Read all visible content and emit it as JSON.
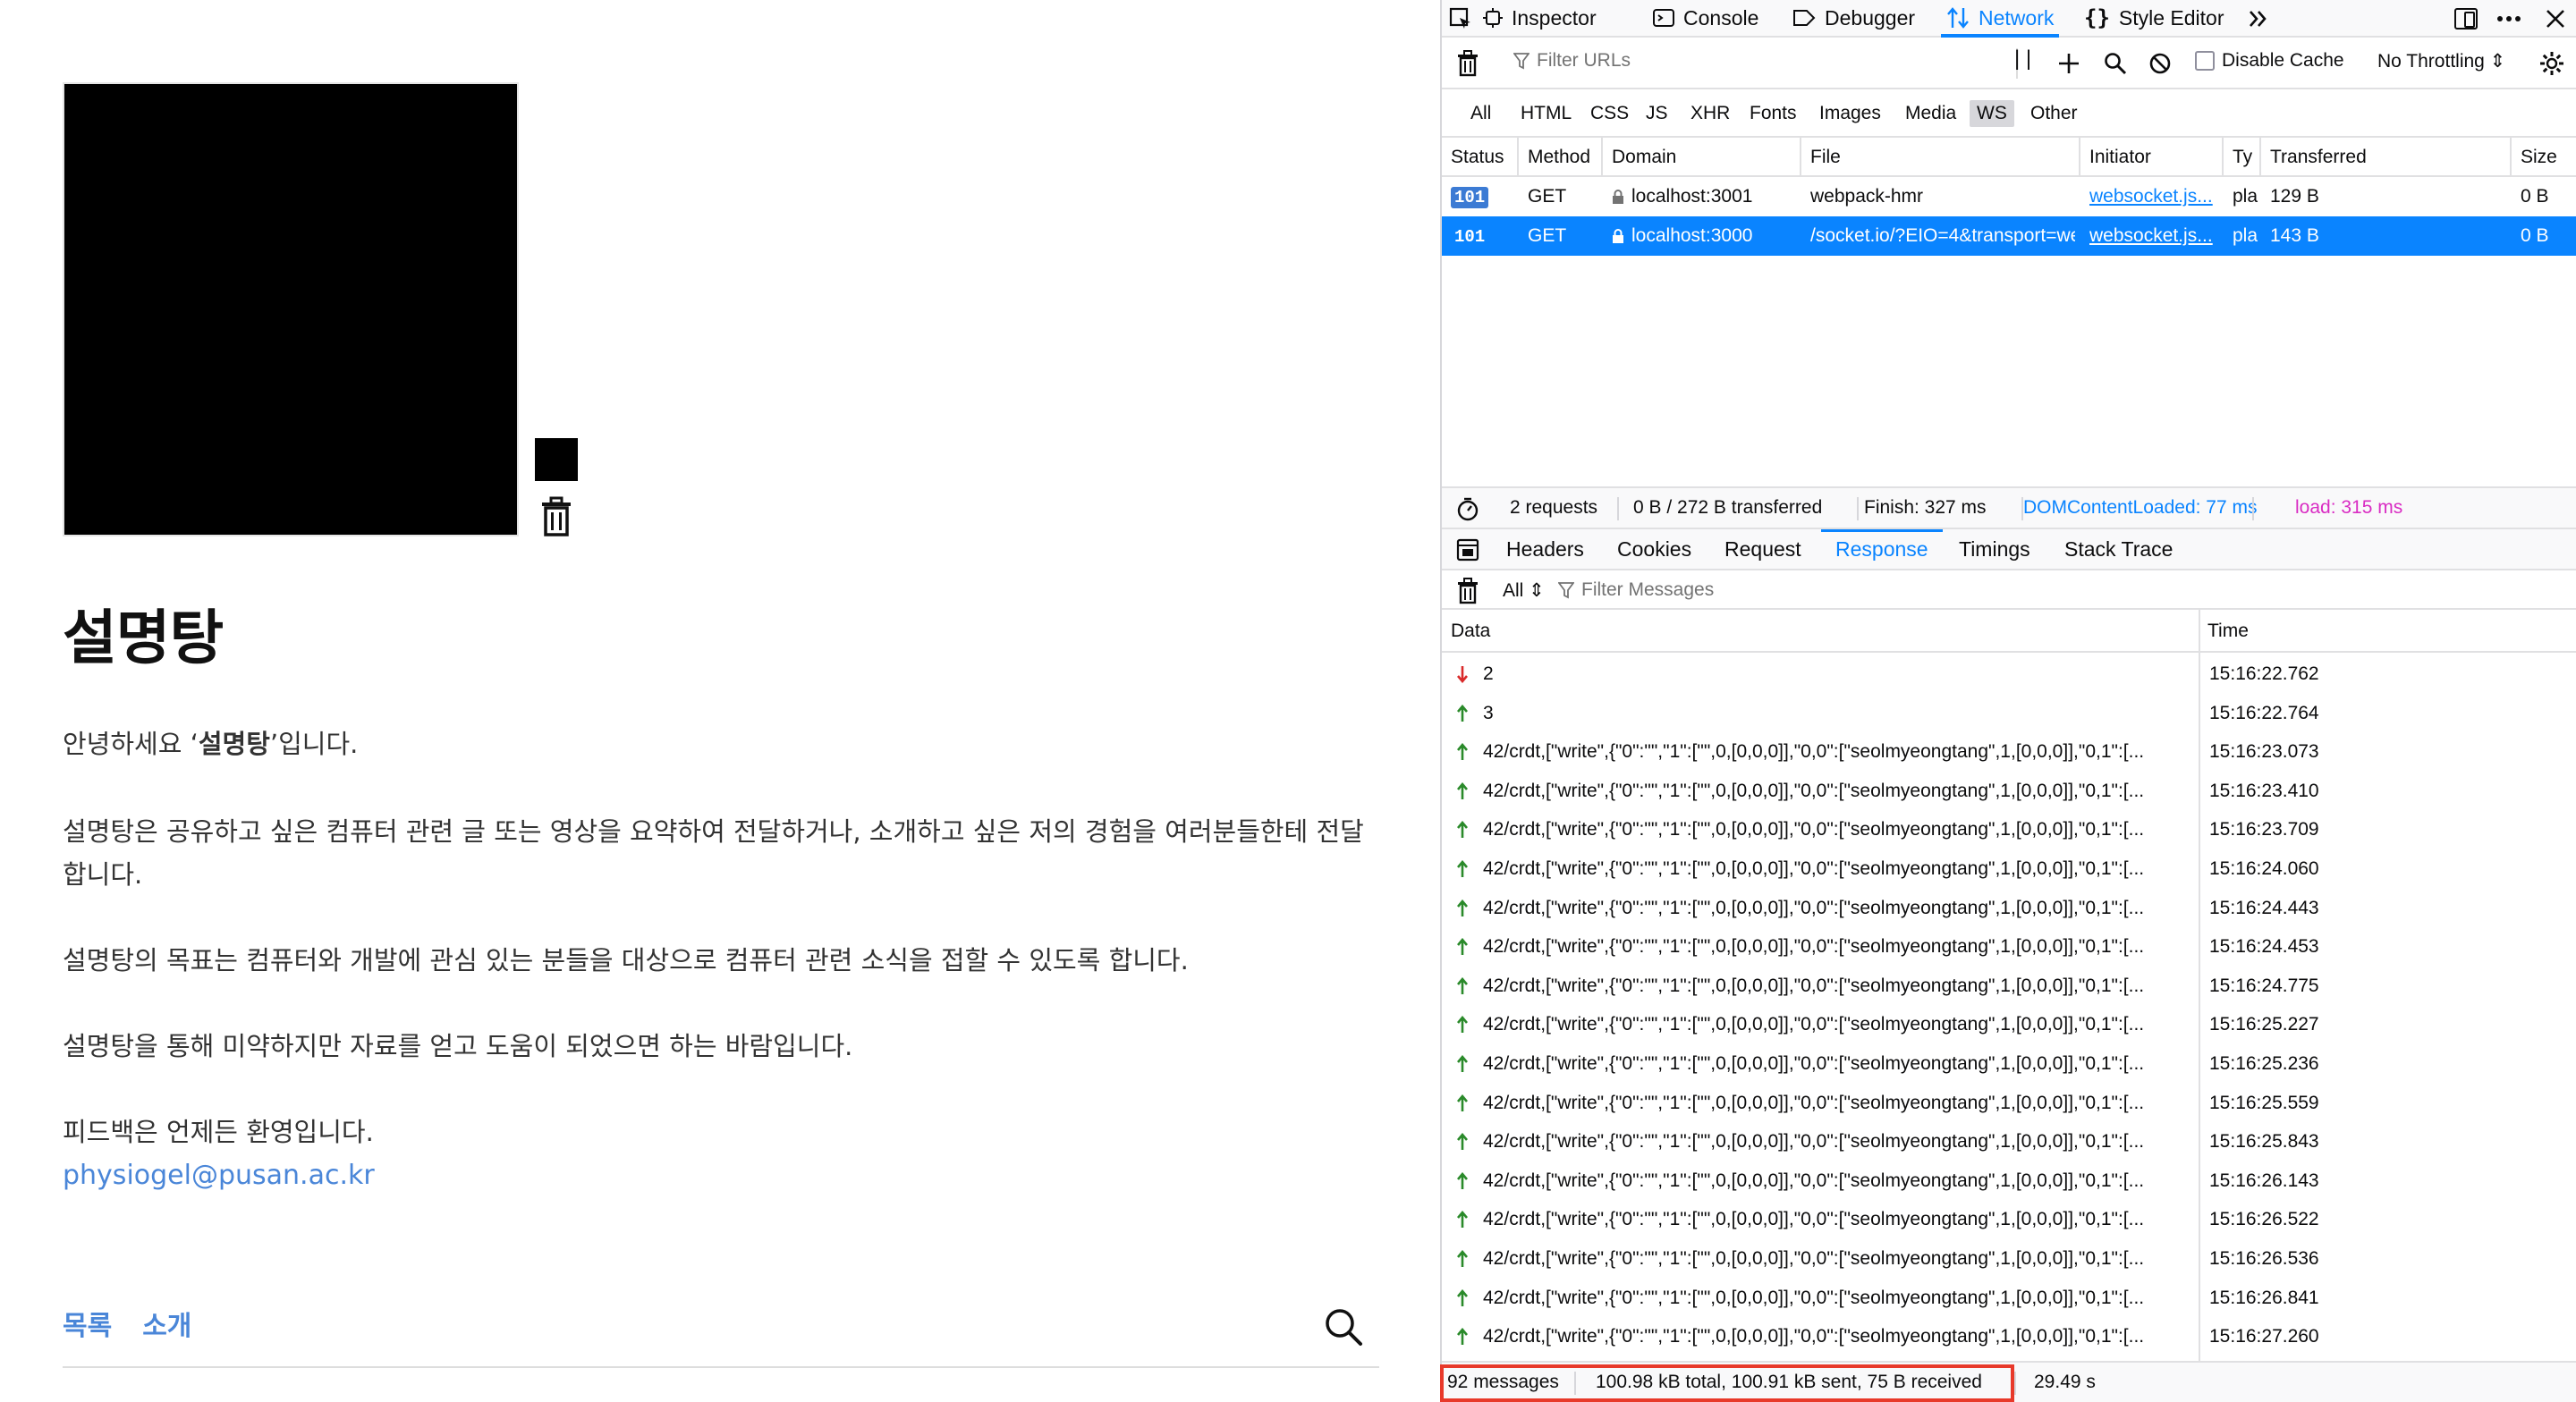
{
  "blog": {
    "title": "설명탕",
    "intro_prefix": "안녕하세요 ‘",
    "intro_bold": "설명탕",
    "intro_suffix": "’입니다.",
    "paragraph_2": "설명탕은 공유하고 싶은 컴퓨터 관련 글 또는 영상을 요약하여 전달하거나, 소개하고 싶은 저의 경험을 여러분들한테 전달합니다.",
    "paragraph_3": "설명탕의 목표는 컴퓨터와 개발에 관심 있는 분들을 대상으로 컴퓨터 관련 소식을 접할 수 있도록 합니다.",
    "paragraph_4": "설명탕을 통해 미약하지만 자료를 얻고 도움이 되었으면 하는 바람입니다.",
    "paragraph_5": "피드백은 언제든 환영입니다.",
    "email": "physiogel@pusan.ac.kr",
    "nav": [
      "목록",
      "소개"
    ],
    "icons": {
      "trash": "trash-icon",
      "search": "search-icon"
    }
  },
  "devtools": {
    "toolbar": {
      "tabs": [
        "Inspector",
        "Console",
        "Debugger",
        "Network",
        "Style Editor"
      ],
      "active_tab": "Network",
      "icons": [
        "pick-element-icon",
        "inspector-icon",
        "console-icon",
        "debugger-icon",
        "network-icon",
        "style-editor-icon",
        "more-tabs-icon",
        "responsive-icon",
        "meatball-icon",
        "close-icon"
      ]
    },
    "filter": {
      "placeholder": "Filter URLs",
      "disable_cache": "Disable Cache",
      "throttling": "No Throttling ⇕"
    },
    "types": [
      "All",
      "HTML",
      "CSS",
      "JS",
      "XHR",
      "Fonts",
      "Images",
      "Media",
      "WS",
      "Other"
    ],
    "active_type": "WS",
    "request_columns": [
      "Status",
      "Method",
      "Domain",
      "File",
      "Initiator",
      "Ty",
      "Transferred",
      "Size"
    ],
    "requests": [
      {
        "status": "101",
        "method": "GET",
        "domain": "localhost:3001",
        "file": "webpack-hmr",
        "initiator": "websocket.js...",
        "type": "pla",
        "transferred": "129 B",
        "size": "0 B",
        "selected": false
      },
      {
        "status": "101",
        "method": "GET",
        "domain": "localhost:3000",
        "file": "/socket.io/?EIO=4&transport=websocket",
        "initiator": "websocket.js...",
        "type": "pla",
        "transferred": "143 B",
        "size": "0 B",
        "selected": true
      }
    ],
    "summary": {
      "requests": "2 requests",
      "transferred": "0 B / 272 B transferred",
      "finish": "Finish: 327 ms",
      "dom_loaded": "DOMContentLoaded: 77 ms",
      "load": "load: 315 ms",
      "dom_color": "#0a84ff",
      "load_color": "#d92cc3"
    },
    "detail_tabs": [
      "Headers",
      "Cookies",
      "Request",
      "Response",
      "Timings",
      "Stack Trace"
    ],
    "active_detail_tab": "Response",
    "ws_filter": {
      "all": "All ⇕",
      "placeholder": "Filter Messages"
    },
    "message_columns": [
      "Data",
      "Time"
    ],
    "messages": [
      {
        "dir": "down",
        "data": "2",
        "time": "15:16:22.762"
      },
      {
        "dir": "up",
        "data": "3",
        "time": "15:16:22.764"
      },
      {
        "dir": "up",
        "data": "42/crdt,[\"write\",{\"0\":\"\",\"1\":[\"\",0,[0,0,0]],\"0,0\":[\"seolmyeongtang\",1,[0,0,0]],\"0,1\":[...",
        "time": "15:16:23.073"
      },
      {
        "dir": "up",
        "data": "42/crdt,[\"write\",{\"0\":\"\",\"1\":[\"\",0,[0,0,0]],\"0,0\":[\"seolmyeongtang\",1,[0,0,0]],\"0,1\":[...",
        "time": "15:16:23.410"
      },
      {
        "dir": "up",
        "data": "42/crdt,[\"write\",{\"0\":\"\",\"1\":[\"\",0,[0,0,0]],\"0,0\":[\"seolmyeongtang\",1,[0,0,0]],\"0,1\":[...",
        "time": "15:16:23.709"
      },
      {
        "dir": "up",
        "data": "42/crdt,[\"write\",{\"0\":\"\",\"1\":[\"\",0,[0,0,0]],\"0,0\":[\"seolmyeongtang\",1,[0,0,0]],\"0,1\":[...",
        "time": "15:16:24.060"
      },
      {
        "dir": "up",
        "data": "42/crdt,[\"write\",{\"0\":\"\",\"1\":[\"\",0,[0,0,0]],\"0,0\":[\"seolmyeongtang\",1,[0,0,0]],\"0,1\":[...",
        "time": "15:16:24.443"
      },
      {
        "dir": "up",
        "data": "42/crdt,[\"write\",{\"0\":\"\",\"1\":[\"\",0,[0,0,0]],\"0,0\":[\"seolmyeongtang\",1,[0,0,0]],\"0,1\":[...",
        "time": "15:16:24.453"
      },
      {
        "dir": "up",
        "data": "42/crdt,[\"write\",{\"0\":\"\",\"1\":[\"\",0,[0,0,0]],\"0,0\":[\"seolmyeongtang\",1,[0,0,0]],\"0,1\":[...",
        "time": "15:16:24.775"
      },
      {
        "dir": "up",
        "data": "42/crdt,[\"write\",{\"0\":\"\",\"1\":[\"\",0,[0,0,0]],\"0,0\":[\"seolmyeongtang\",1,[0,0,0]],\"0,1\":[...",
        "time": "15:16:25.227"
      },
      {
        "dir": "up",
        "data": "42/crdt,[\"write\",{\"0\":\"\",\"1\":[\"\",0,[0,0,0]],\"0,0\":[\"seolmyeongtang\",1,[0,0,0]],\"0,1\":[...",
        "time": "15:16:25.236"
      },
      {
        "dir": "up",
        "data": "42/crdt,[\"write\",{\"0\":\"\",\"1\":[\"\",0,[0,0,0]],\"0,0\":[\"seolmyeongtang\",1,[0,0,0]],\"0,1\":[...",
        "time": "15:16:25.559"
      },
      {
        "dir": "up",
        "data": "42/crdt,[\"write\",{\"0\":\"\",\"1\":[\"\",0,[0,0,0]],\"0,0\":[\"seolmyeongtang\",1,[0,0,0]],\"0,1\":[...",
        "time": "15:16:25.843"
      },
      {
        "dir": "up",
        "data": "42/crdt,[\"write\",{\"0\":\"\",\"1\":[\"\",0,[0,0,0]],\"0,0\":[\"seolmyeongtang\",1,[0,0,0]],\"0,1\":[...",
        "time": "15:16:26.143"
      },
      {
        "dir": "up",
        "data": "42/crdt,[\"write\",{\"0\":\"\",\"1\":[\"\",0,[0,0,0]],\"0,0\":[\"seolmyeongtang\",1,[0,0,0]],\"0,1\":[...",
        "time": "15:16:26.522"
      },
      {
        "dir": "up",
        "data": "42/crdt,[\"write\",{\"0\":\"\",\"1\":[\"\",0,[0,0,0]],\"0,0\":[\"seolmyeongtang\",1,[0,0,0]],\"0,1\":[...",
        "time": "15:16:26.536"
      },
      {
        "dir": "up",
        "data": "42/crdt,[\"write\",{\"0\":\"\",\"1\":[\"\",0,[0,0,0]],\"0,0\":[\"seolmyeongtang\",1,[0,0,0]],\"0,1\":[...",
        "time": "15:16:26.841"
      },
      {
        "dir": "up",
        "data": "42/crdt,[\"write\",{\"0\":\"\",\"1\":[\"\",0,[0,0,0]],\"0,0\":[\"seolmyeongtang\",1,[0,0,0]],\"0,1\":[...",
        "time": "15:16:27.260"
      }
    ],
    "footer": {
      "messages": "92 messages",
      "totals": "100.98 kB total, 100.91 kB sent, 75 B received",
      "duration": "29.49 s",
      "highlight_color": "#e8392a"
    },
    "colors": {
      "accent": "#0a84ff",
      "sent_arrow": "#2a8a2a",
      "received_arrow": "#d92a2a"
    }
  }
}
